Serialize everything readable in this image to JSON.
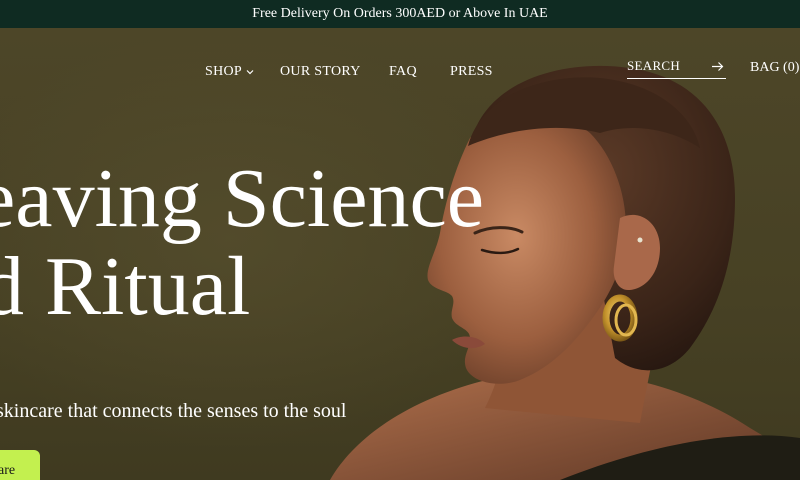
{
  "announcement": {
    "text": "Free Delivery On Orders 300AED or Above In UAE"
  },
  "nav": {
    "items": [
      {
        "label": "SHOP"
      },
      {
        "label": "OUR STORY"
      },
      {
        "label": "FAQ"
      },
      {
        "label": "PRESS"
      }
    ],
    "search_label": "SEARCH",
    "bag_label": "BAG (0)"
  },
  "hero": {
    "headline_line1": "eaving Science",
    "headline_line2": "nd Ritual",
    "subline": "skincare that connects the senses to the soul",
    "cta_label": "are"
  },
  "colors": {
    "announcement_bg": "#0f2b22",
    "hero_bg": "#4a4426",
    "cta_bg": "#c3f04f"
  },
  "icons": {
    "shop_dropdown": "chevron-down-icon",
    "search_submit": "arrow-right-icon"
  }
}
